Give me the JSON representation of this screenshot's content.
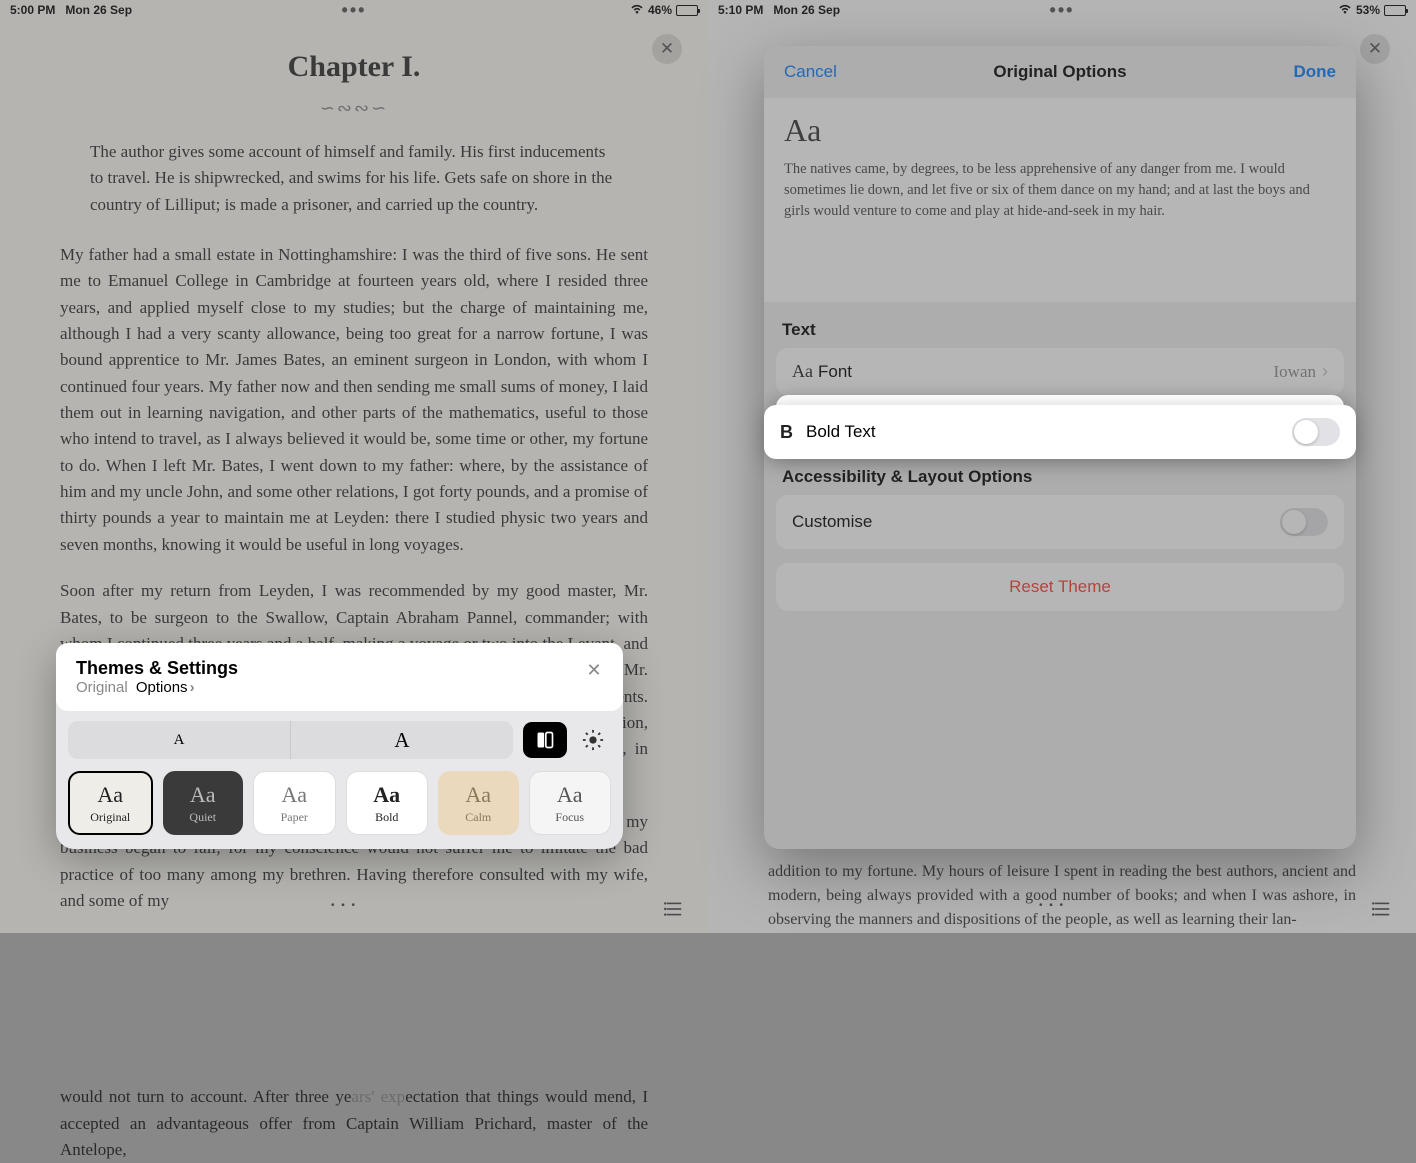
{
  "left": {
    "status": {
      "time": "5:00 PM",
      "date": "Mon 26 Sep",
      "battery": "46%"
    },
    "chapter_title": "Chapter I.",
    "ornament": "∽∾∾∽",
    "summary": "The author gives some account of himself and family.  His first inducements to travel.  He is shipwrecked, and swims for his life.  Gets safe on shore in the country of Lilliput; is made a prisoner, and carried up the country.",
    "para1": "My father had a small estate in Nottinghamshire: I was the third of five sons.  He sent me to Emanuel College in Cambridge at fourteen years old, where I resided three years, and applied myself close to my studies; but the charge of maintaining me, although I had a very scanty allowance, being too great for a narrow fortune, I was bound apprentice to Mr. James Bates, an eminent surgeon in London, with whom I continued four years.  My father now and then sending me small sums of money, I laid them out in learning navigation, and other parts of the mathematics, useful to those who intend to travel, as I always believed it would be, some time or other, my fortune to do.  When I left Mr. Bates, I went down to my father: where, by the assistance of him and my uncle John, and some other relations, I got forty pounds, and a promise of thirty pounds a year to maintain me at Leyden: there I studied physic two years and seven months, knowing it would be useful in long voyages.",
    "para2": "Soon after my return from Leyden, I was recommended by my good master, Mr. Bates, to be surgeon to the Swallow, Captain Abraham Pannel, commander; with whom I continued three years and a half, making a voyage or two into the Levant, and some other parts.  When I came back I resolved to settle in London; to which Mr. Bates, my master, encouraged me, and by him I was recommended to several patients.  I took part of a small house in the Old Jewry; and being advised to alter my condition, I married Mrs. Mary Burton, second daughter to Mr. Edmund Burton, hosier, in Newgate-street, with whom I received four hundred pounds for a portion.",
    "para3": "But my good master Bates dying in two years after, and I having few friends, my business began to fail; for my conscience would not suffer me to imitate the bad practice of too many among my brethren.  Having therefore consulted with my wife, and some of my",
    "para4_a": "would not turn to account.  After three ye",
    "para4_b": "ectation that things would mend, I accepted an advantageous offer from Captain William Prichard, master of the Antelope,",
    "themes": {
      "title": "Themes & Settings",
      "sub_prefix": "Original",
      "sub_link": "Options",
      "size_small": "A",
      "size_large": "A",
      "tiles": {
        "original": "Original",
        "quiet": "Quiet",
        "paper": "Paper",
        "bold": "Bold",
        "calm": "Calm",
        "focus": "Focus"
      }
    }
  },
  "right": {
    "status": {
      "time": "5:10 PM",
      "date": "Mon 26 Sep",
      "battery": "53%"
    },
    "para_bottom": "addition to my fortune.  My hours of leisure I spent in reading the best authors, ancient and modern, being always provided with a good number of books; and when I was ashore, in observing the manners and dispositions of the people, as well as learning their lan-",
    "modal": {
      "cancel": "Cancel",
      "title": "Original Options",
      "done": "Done",
      "aa": "Aa",
      "sample": "The natives came, by degrees, to be less apprehensive of any danger from me.  I would sometimes lie down, and let five or six of them dance on my hand; and at last the boys and girls would venture to come and play at hide-and-seek in my hair.",
      "section_text": "Text",
      "font_label": "Font",
      "font_value": "Iowan",
      "bold_label": "Bold Text",
      "section_access": "Accessibility & Layout Options",
      "customise": "Customise",
      "reset": "Reset Theme"
    }
  }
}
